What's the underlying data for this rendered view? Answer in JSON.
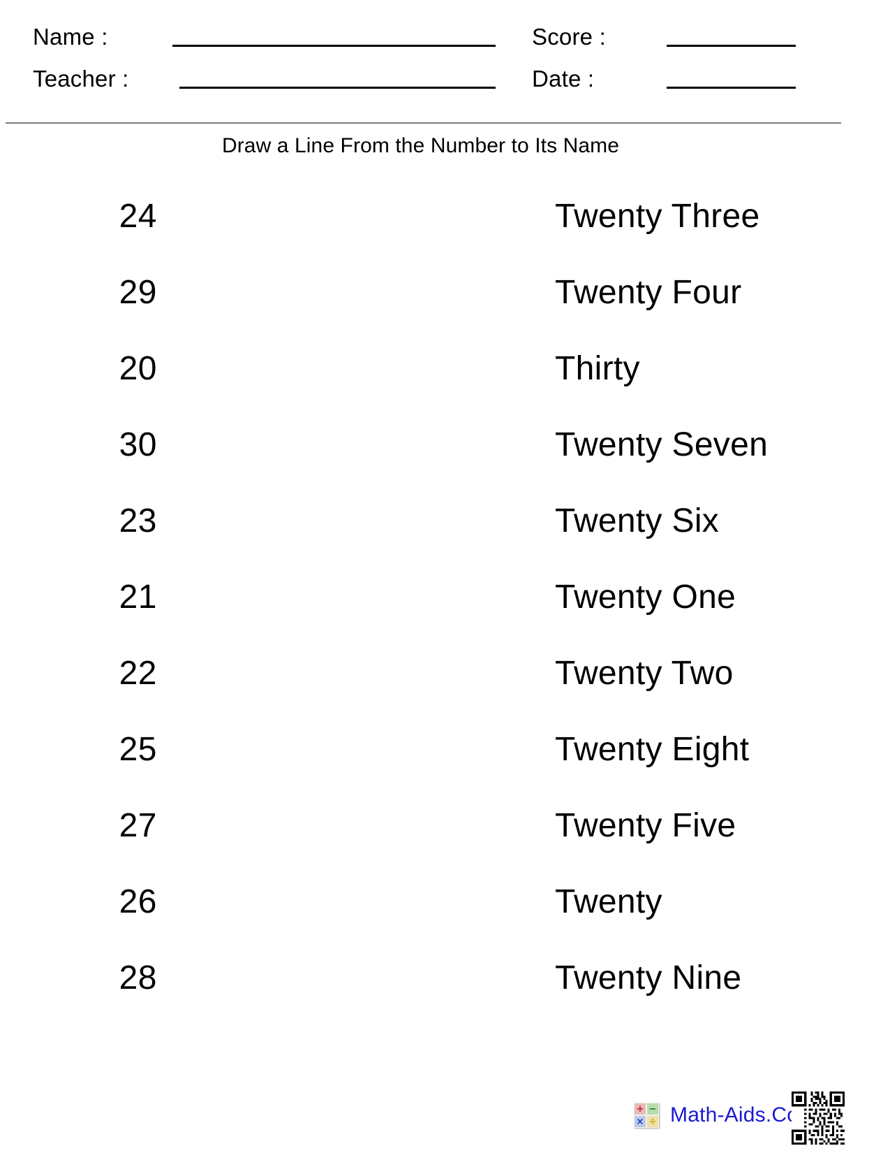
{
  "header": {
    "fields": [
      {
        "label": "Name :",
        "value": ""
      },
      {
        "label": "Teacher :",
        "value": ""
      },
      {
        "label": "Score :",
        "value": ""
      },
      {
        "label": "Date :",
        "value": ""
      }
    ]
  },
  "title": "Draw a Line From the Number to Its Name",
  "exercise": {
    "type": "matching",
    "left_column_heading": "",
    "right_column_heading": "",
    "numbers": [
      "24",
      "29",
      "20",
      "30",
      "23",
      "21",
      "22",
      "25",
      "27",
      "26",
      "28"
    ],
    "names": [
      "Twenty Three",
      "Twenty Four",
      "Thirty",
      "Twenty Seven",
      "Twenty Six",
      "Twenty One",
      "Twenty Two",
      "Twenty Eight",
      "Twenty Five",
      "Twenty",
      "Twenty Nine"
    ]
  },
  "footer": {
    "brand_text": "Math-Aids.Com",
    "brand_color": "#1a1ad2",
    "logo_tiles": [
      {
        "name": "plus-tile",
        "glyph": "+",
        "background": "#e8b9bc",
        "color": "#c2151a"
      },
      {
        "name": "minus-tile",
        "glyph": "−",
        "background": "#b8dcb0",
        "color": "#14761a"
      },
      {
        "name": "times-tile",
        "glyph": "×",
        "background": "#b9c9e8",
        "color": "#1535bb"
      },
      {
        "name": "divide-tile",
        "glyph": "÷",
        "background": "#efe0a4",
        "color": "#c8a60c"
      }
    ],
    "qr_label": "qr-code"
  }
}
